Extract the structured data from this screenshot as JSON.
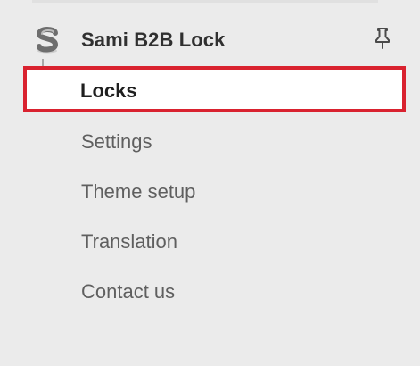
{
  "app": {
    "title": "Sami B2B Lock",
    "logo_icon": "sami-logo-icon",
    "pin_icon": "pin-icon"
  },
  "nav": {
    "selected": "Locks",
    "items": [
      {
        "label": "Locks",
        "selected": true
      },
      {
        "label": "Settings",
        "selected": false
      },
      {
        "label": "Theme setup",
        "selected": false
      },
      {
        "label": "Translation",
        "selected": false
      },
      {
        "label": "Contact us",
        "selected": false
      }
    ]
  },
  "colors": {
    "background": "#ebebeb",
    "selection_outline": "#d9222f",
    "selected_bg": "#ffffff",
    "text_primary": "#303030",
    "text_secondary": "#5f5f5f"
  }
}
